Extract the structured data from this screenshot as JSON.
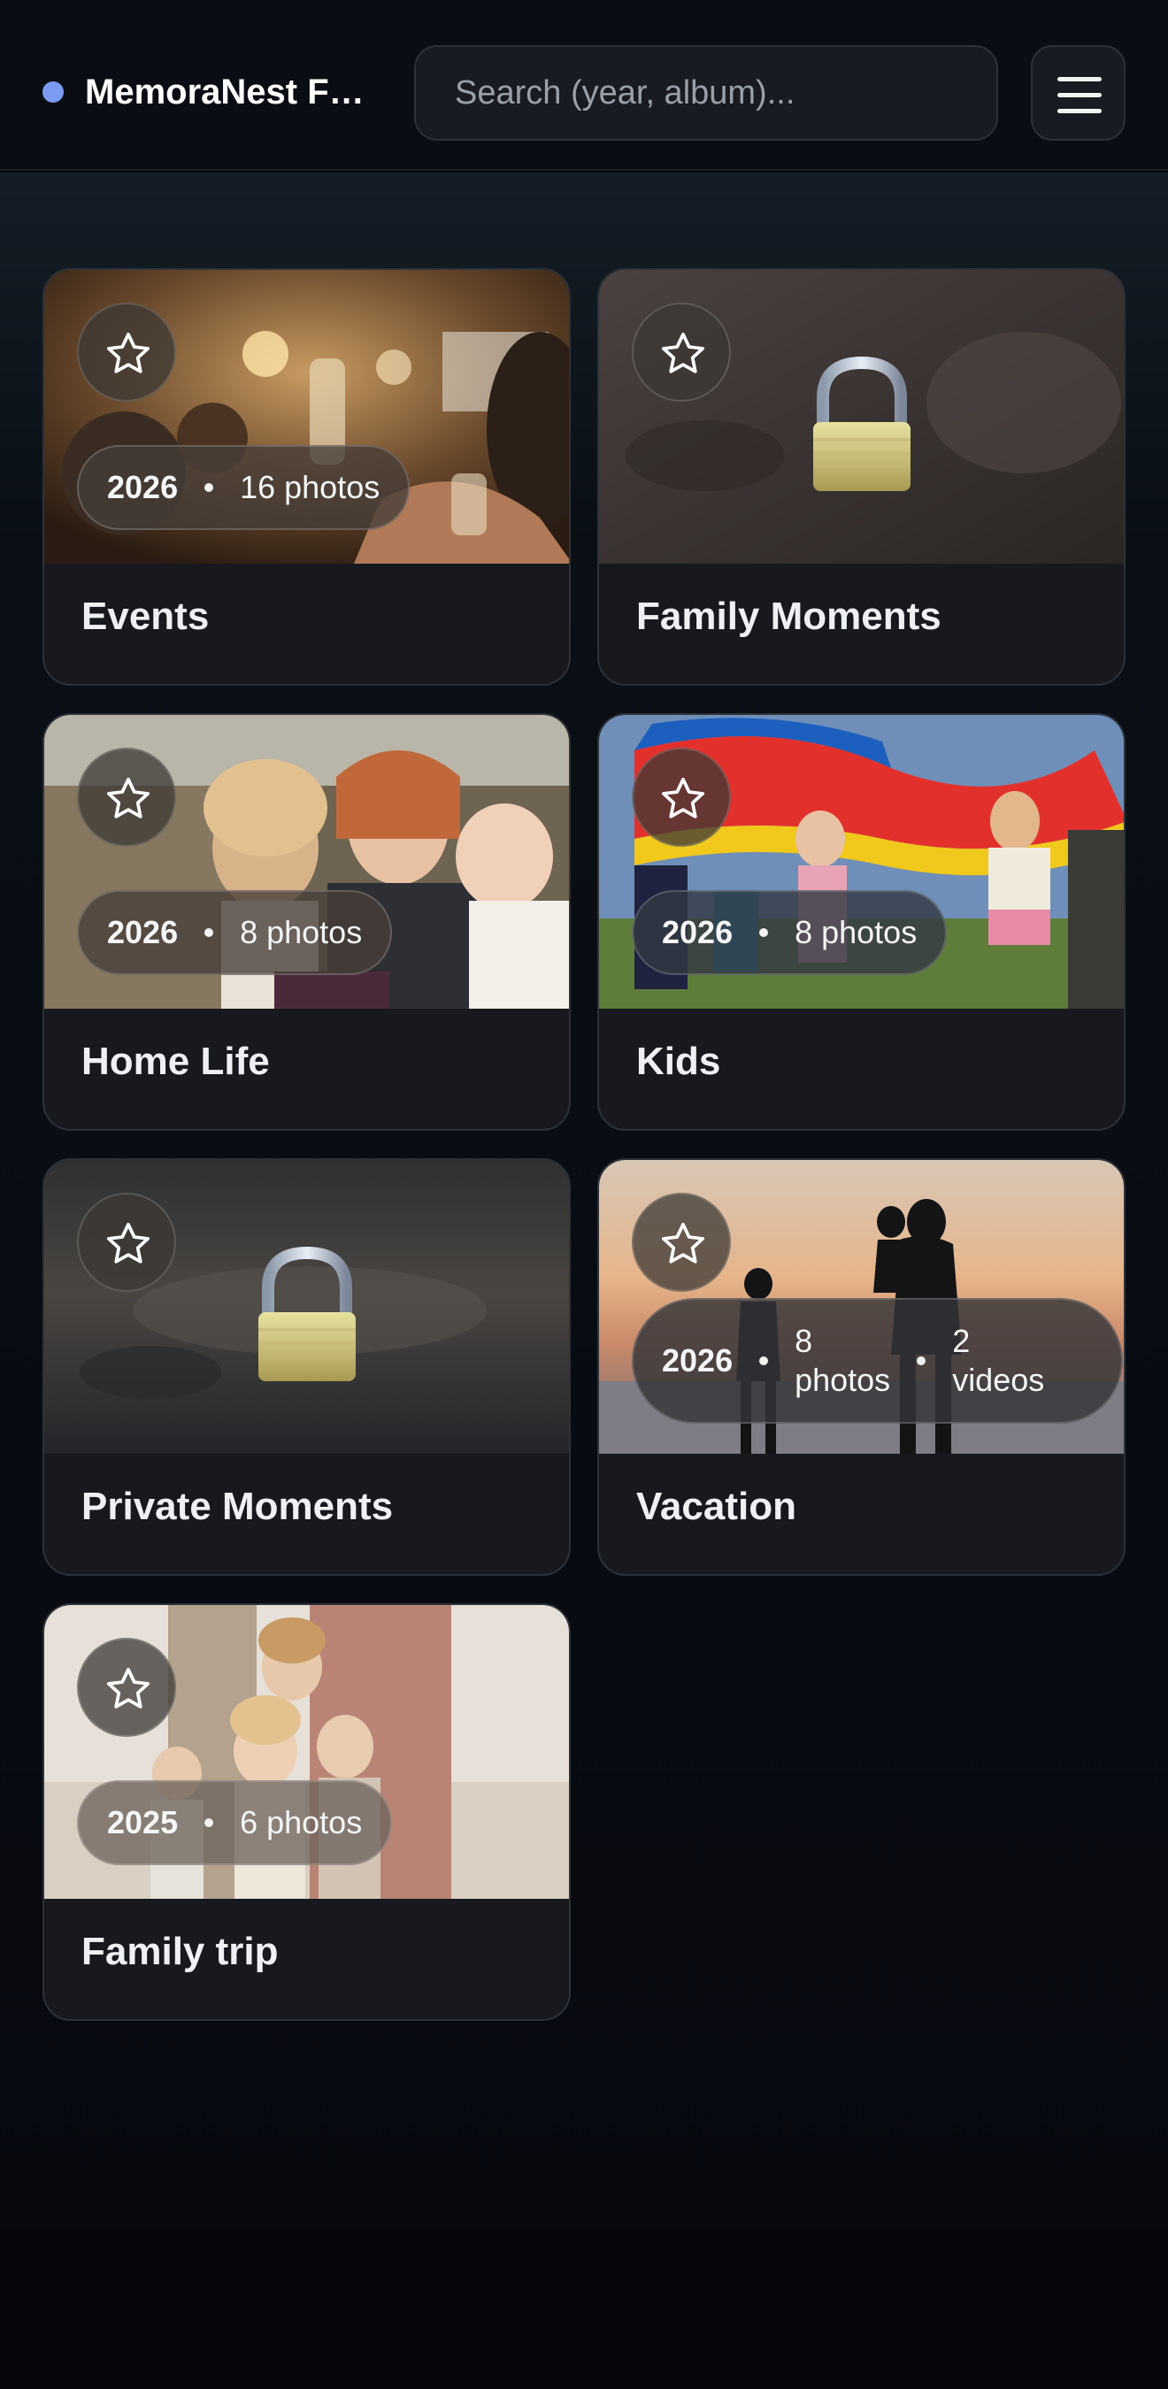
{
  "header": {
    "app_title": "MemoraNest Fa...",
    "search_placeholder": "Search (year, album)...",
    "menu_icon": "hamburger-menu-icon"
  },
  "albums": [
    {
      "title": "Events",
      "year": "2026",
      "photos": "16 photos",
      "locked": false,
      "icon": "star-icon"
    },
    {
      "title": "Family Moments",
      "locked": true,
      "icon": "star-icon",
      "lock_icon": "padlock-icon"
    },
    {
      "title": "Home Life",
      "year": "2026",
      "photos": "8 photos",
      "locked": false,
      "icon": "star-icon"
    },
    {
      "title": "Kids",
      "year": "2026",
      "photos": "8 photos",
      "locked": false,
      "icon": "star-icon"
    },
    {
      "title": "Private Moments",
      "locked": true,
      "icon": "star-icon",
      "lock_icon": "padlock-icon"
    },
    {
      "title": "Vacation",
      "year": "2026",
      "photos_line1": "8",
      "photos_line2": "photos",
      "videos_line1": "2",
      "videos_line2": "videos",
      "locked": false,
      "icon": "star-icon"
    },
    {
      "title": "Family trip",
      "year": "2025",
      "photos": "6 photos",
      "locked": false,
      "icon": "star-icon"
    }
  ],
  "colors": {
    "accent_dot": "#7b9bf0",
    "background": "#05070b",
    "card": "#17191f"
  }
}
